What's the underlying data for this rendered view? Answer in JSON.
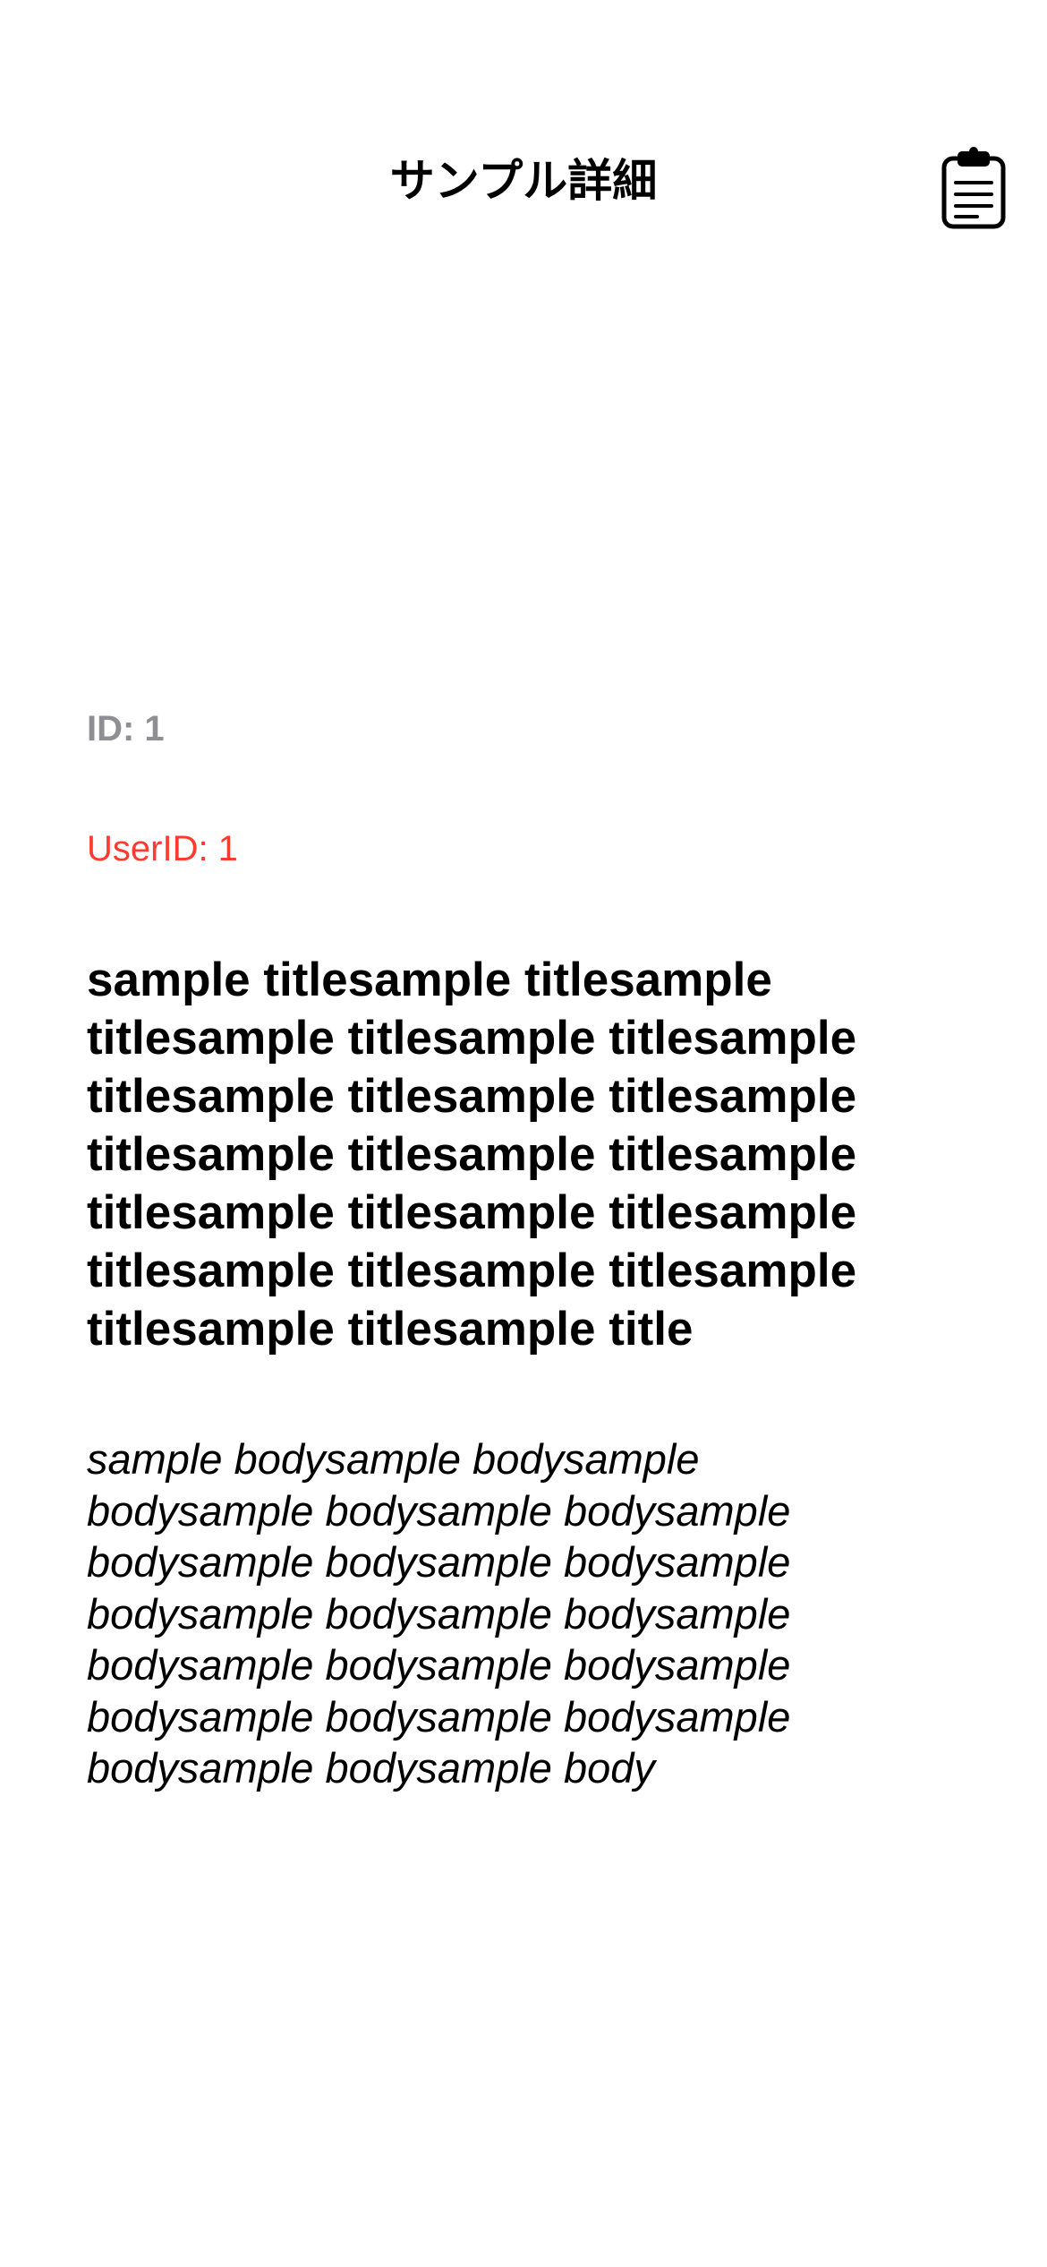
{
  "nav": {
    "title": "サンプル詳細",
    "clipboard_icon": "clipboard-icon"
  },
  "detail": {
    "id_text": "ID: 1",
    "user_id_text": "UserID: 1",
    "title": "sample titlesample titlesample titlesample titlesample titlesample titlesample titlesample titlesample titlesample titlesample titlesample titlesample titlesample titlesample titlesample titlesample titlesample titlesample titlesample title",
    "body": "sample bodysample bodysample bodysample bodysample bodysample bodysample bodysample bodysample bodysample bodysample bodysample bodysample bodysample bodysample bodysample bodysample bodysample bodysample bodysample body"
  },
  "colors": {
    "id_text": "#8e8e93",
    "user_id_text": "#ff3b30",
    "primary_text": "#000000",
    "background": "#ffffff"
  }
}
